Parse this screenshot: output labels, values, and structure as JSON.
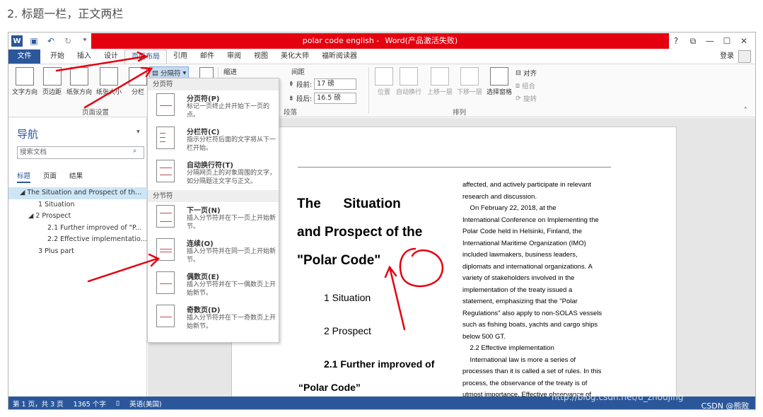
{
  "blog_heading": "2. 标题一栏，正文两栏",
  "window": {
    "title_doc": "polar code english -",
    "title_app": "Word(产品激活失败)",
    "controls": [
      "?",
      "⧉",
      "—",
      "☐",
      "✕"
    ]
  },
  "tabs": [
    {
      "label": "文件"
    },
    {
      "label": "开始"
    },
    {
      "label": "插入"
    },
    {
      "label": "设计"
    },
    {
      "label": "页面布局"
    },
    {
      "label": "引用"
    },
    {
      "label": "邮件"
    },
    {
      "label": "审阅"
    },
    {
      "label": "视图"
    },
    {
      "label": "美化大师"
    },
    {
      "label": "福昕阅读器"
    }
  ],
  "login": "登录",
  "ribbon": {
    "page_setup": {
      "buttons": [
        "文字方向",
        "页边距",
        "纸张方向",
        "纸张大小",
        "分栏"
      ],
      "group_label": "页面设置",
      "breaks_label": "分隔符"
    },
    "indent_label": "缩进",
    "spacing": {
      "label": "间距",
      "before_label": "段前:",
      "before_value": "17 磅",
      "after_label": "段后:",
      "after_value": "16.5 磅"
    },
    "paragraph_label": "段落",
    "arrange": {
      "buttons": [
        "位置",
        "自动换行",
        "上移一层",
        "下移一层",
        "选择窗格"
      ],
      "small": [
        "对齐",
        "组合",
        "旋转"
      ],
      "group_label": "排列"
    }
  },
  "breaks_menu": {
    "section1": "分页符",
    "section2": "分节符",
    "items": [
      {
        "title": "分页符(P)",
        "desc": "标记一页终止并开始下一页的点。"
      },
      {
        "title": "分栏符(C)",
        "desc": "指示分栏符后面的文字将从下一栏开始。"
      },
      {
        "title": "自动换行符(T)",
        "desc": "分隔网页上的对象周围的文字，如分隔题注文字与正文。"
      },
      {
        "title": "下一页(N)",
        "desc": "插入分节符并在下一页上开始新节。"
      },
      {
        "title": "连续(O)",
        "desc": "插入分节符并在同一页上开始新节。"
      },
      {
        "title": "偶数页(E)",
        "desc": "插入分节符并在下一偶数页上开始新节。"
      },
      {
        "title": "奇数页(D)",
        "desc": "插入分节符并在下一奇数页上开始新节。"
      }
    ]
  },
  "nav": {
    "title": "导航",
    "search_placeholder": "搜索文档",
    "tabs": [
      "标题",
      "页面",
      "结果"
    ],
    "tree": [
      {
        "label": "◢ The Situation and Prospect of th...",
        "indent": 16,
        "selected": true
      },
      {
        "label": "1 Situation",
        "indent": 42,
        "selected": false
      },
      {
        "label": "◢ 2 Prospect",
        "indent": 28,
        "selected": false
      },
      {
        "label": "2.1 Further improved of \"P...",
        "indent": 55,
        "selected": false
      },
      {
        "label": "2.2 Effective implementatio...",
        "indent": 55,
        "selected": false
      },
      {
        "label": "3 Plus part",
        "indent": 42,
        "selected": false
      }
    ]
  },
  "document": {
    "title_lines": [
      "The      Situation",
      "and Prospect of the",
      "\"Polar Code\""
    ],
    "headings": [
      "1 Situation",
      "2 Prospect",
      "2.1 Further improved of",
      "“Polar Code”"
    ],
    "col2_lines": [
      "affected, and actively participate in relevant",
      "research and discussion.",
      "    On February 22, 2018, at the",
      "International Conference on Implementing the",
      "Polar Code held in Helsinki, Finland, the",
      "International Maritime Organization (IMO)",
      "included lawmakers, business leaders,",
      "diplomats and international organizations. A",
      "variety of stakeholders involved in the",
      "implementation of the treaty issued a",
      "statement, emphasizing that the \"Polar",
      "Regulations\" also apply to non-SOLAS vessels",
      "such as fishing boats, yachts and cargo ships",
      "below 500 GT.",
      "    2.2 Effective implementation",
      "    International law is more a series of",
      "processes than it is called a set of rules. In this",
      "process, the observance of the treaty is of",
      "utmost importance. Effective observance of"
    ]
  },
  "status": {
    "page": "第 1 页，共 3 页",
    "words": "1365 个字",
    "lang": "英语(美国)"
  },
  "watermark": "http://blog.csdn.net/u_zhoujing",
  "csdn": "CSDN @熊败_",
  "accent": "#2b579a",
  "red": "#e5000f"
}
